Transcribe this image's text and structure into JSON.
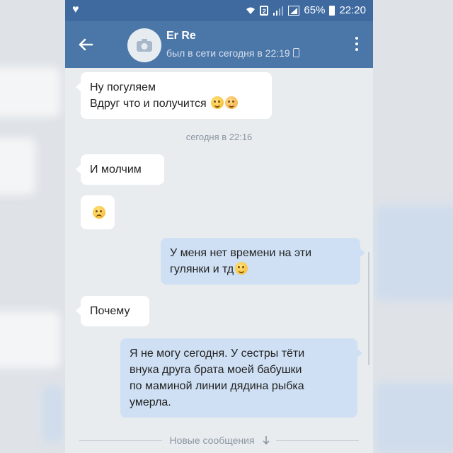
{
  "status_bar": {
    "battery_percent": "65%",
    "time": "22:20",
    "sim_label": "2"
  },
  "header": {
    "contact_name": "Er Re",
    "contact_status": "был в сети сегодня в 22:19"
  },
  "messages": [
    {
      "direction": "in",
      "lines": [
        "Ну погуляем",
        "Вдруг что и получится"
      ],
      "emoji": [
        "smile",
        "blush"
      ]
    },
    {
      "direction": "in",
      "lines": [
        "И молчим"
      ]
    },
    {
      "direction": "in",
      "lines": [],
      "emoji": [
        "sad"
      ]
    },
    {
      "direction": "out",
      "lines": [
        "У меня нет времени на эти",
        "гулянки и тд"
      ],
      "emoji": [
        "smile"
      ]
    },
    {
      "direction": "in",
      "lines": [
        "Почему"
      ]
    },
    {
      "direction": "out",
      "lines": [
        "Я не могу сегодня. У сестры тёти",
        "внука друга брата моей бабушки",
        "по маминой линии дядина рыбка",
        "умерла."
      ]
    }
  ],
  "timestamp_divider": "сегодня в 22:16",
  "new_messages_label": "Новые сообщения",
  "colors": {
    "header_bg": "#4a76a8",
    "status_bg": "#3e6aa0",
    "chat_bg": "#e9ecef",
    "incoming_bubble": "#ffffff",
    "outgoing_bubble": "#cfe0f4"
  },
  "icons": [
    "heart-icon",
    "wifi-icon",
    "signal-icon",
    "battery-icon",
    "back-arrow-icon",
    "camera-icon",
    "phone-icon",
    "more-vert-icon",
    "arrow-down-icon"
  ]
}
